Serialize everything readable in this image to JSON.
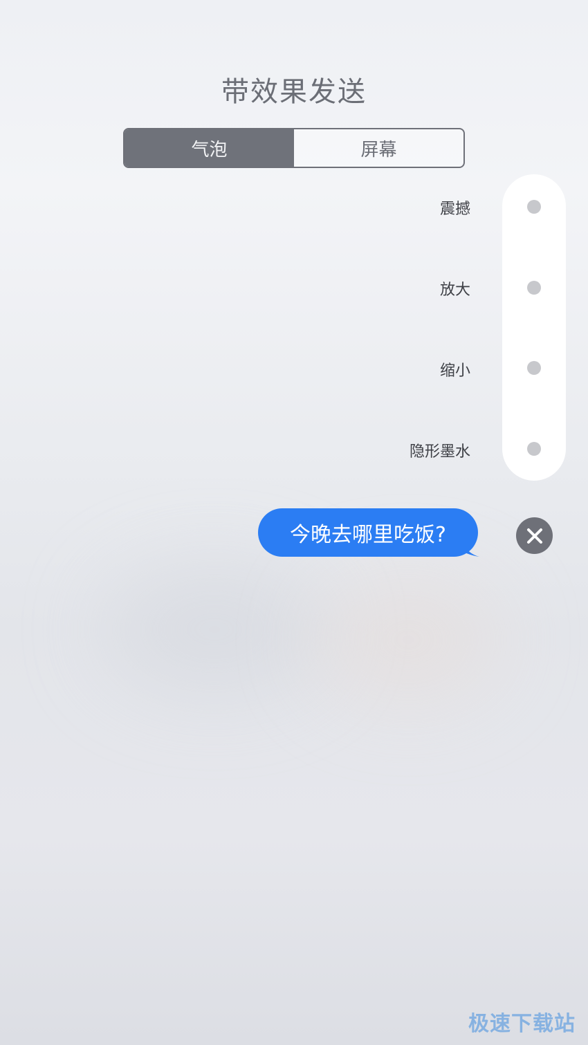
{
  "header": {
    "title": "带效果发送"
  },
  "tabs": [
    {
      "label": "气泡",
      "active": true
    },
    {
      "label": "屏幕",
      "active": false
    }
  ],
  "effects": [
    {
      "label": "震撼"
    },
    {
      "label": "放大"
    },
    {
      "label": "缩小"
    },
    {
      "label": "隐形墨水"
    }
  ],
  "message": {
    "text": "今晚去哪里吃饭?"
  },
  "close": {
    "icon": "close-icon"
  },
  "watermark": {
    "text": "极速下载站"
  },
  "colors": {
    "bubble": "#2b7df3",
    "segment_active": "#6f727a",
    "close_button": "#6e7078"
  }
}
